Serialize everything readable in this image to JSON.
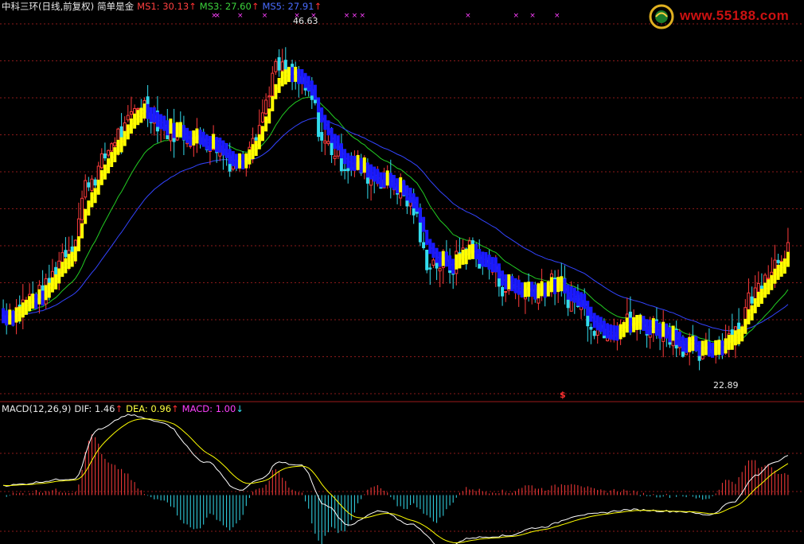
{
  "header": {
    "title": "中科三环(日线,前复权)",
    "indicator_name": "简单是金",
    "ms1_label": "MS1:",
    "ms1_value": "30.13",
    "ms3_label": "MS3:",
    "ms3_value": "27.60",
    "ms5_label": "MS5:",
    "ms5_value": "27.91",
    "up_arrow": "↑",
    "down_arrow": "↓"
  },
  "macd_header": {
    "name": "MACD(12,26,9)",
    "dif_label": "DIF:",
    "dif_value": "1.46",
    "dea_label": "DEA:",
    "dea_value": "0.96",
    "macd_label": "MACD:",
    "macd_value": "1.00"
  },
  "logo": {
    "text": "www.55188.com"
  },
  "colors": {
    "background": "#000000",
    "grid": "#8b1a1a",
    "up": "#ff3b3b",
    "down": "#33ddee",
    "ms1": "#ff2020",
    "ms3": "#22cc22",
    "ms5": "#3344ff",
    "signal_up": "#ffff00",
    "signal_down": "#1a1aff",
    "dif": "#ffffff",
    "dea": "#ffff00",
    "x_marker": "#ff40ff"
  },
  "chart_data": {
    "type": "candlestick",
    "price_axis_range": [
      20.5,
      48.5
    ],
    "high_annotation": "46.63",
    "low_annotation": "22.89",
    "signal_mark": "$",
    "x_mark": "×",
    "x_mark_positions": [
      0.266,
      0.27,
      0.299,
      0.33,
      0.371,
      0.392,
      0.434,
      0.444,
      0.454,
      0.588,
      0.649,
      0.67,
      0.701
    ],
    "price_keypoints": [
      [
        0,
        26.5
      ],
      [
        0.045,
        28.0
      ],
      [
        0.085,
        31.5
      ],
      [
        0.11,
        36.5
      ],
      [
        0.15,
        39.8
      ],
      [
        0.175,
        42.0
      ],
      [
        0.21,
        40.0
      ],
      [
        0.26,
        39.3
      ],
      [
        0.3,
        37.5
      ],
      [
        0.32,
        40.0
      ],
      [
        0.35,
        44.5
      ],
      [
        0.37,
        44.0
      ],
      [
        0.39,
        42.5
      ],
      [
        0.41,
        39.0
      ],
      [
        0.44,
        37.5
      ],
      [
        0.48,
        36.5
      ],
      [
        0.5,
        36.0
      ],
      [
        0.52,
        34.5
      ],
      [
        0.54,
        30.5
      ],
      [
        0.57,
        30.0
      ],
      [
        0.59,
        31.5
      ],
      [
        0.62,
        30.0
      ],
      [
        0.64,
        28.5
      ],
      [
        0.66,
        28.3
      ],
      [
        0.7,
        28.8
      ],
      [
        0.73,
        27.5
      ],
      [
        0.76,
        25.5
      ],
      [
        0.8,
        26.0
      ],
      [
        0.83,
        25.6
      ],
      [
        0.85,
        25.2
      ],
      [
        0.87,
        24.2
      ],
      [
        0.89,
        23.5
      ],
      [
        0.91,
        24.5
      ],
      [
        0.935,
        25.5
      ],
      [
        0.955,
        28.0
      ],
      [
        0.975,
        30.0
      ],
      [
        1,
        31.5
      ]
    ],
    "macd_axis_range": [
      -1.5,
      2.5
    ],
    "macd_keypoints": [
      [
        0,
        0.3
      ],
      [
        0.09,
        0.5
      ],
      [
        0.12,
        2.0
      ],
      [
        0.16,
        2.45
      ],
      [
        0.2,
        2.25
      ],
      [
        0.26,
        1.0
      ],
      [
        0.3,
        0.15
      ],
      [
        0.33,
        0.5
      ],
      [
        0.35,
        1.0
      ],
      [
        0.38,
        0.9
      ],
      [
        0.41,
        -0.3
      ],
      [
        0.44,
        -0.9
      ],
      [
        0.48,
        -0.5
      ],
      [
        0.52,
        -0.9
      ],
      [
        0.56,
        -1.6
      ],
      [
        0.6,
        -1.3
      ],
      [
        0.64,
        -1.25
      ],
      [
        0.68,
        -1.0
      ],
      [
        0.74,
        -0.6
      ],
      [
        0.8,
        -0.45
      ],
      [
        0.86,
        -0.5
      ],
      [
        0.9,
        -0.6
      ],
      [
        0.93,
        -0.2
      ],
      [
        0.96,
        0.6
      ],
      [
        0.98,
        1.0
      ],
      [
        1,
        1.2
      ]
    ]
  }
}
